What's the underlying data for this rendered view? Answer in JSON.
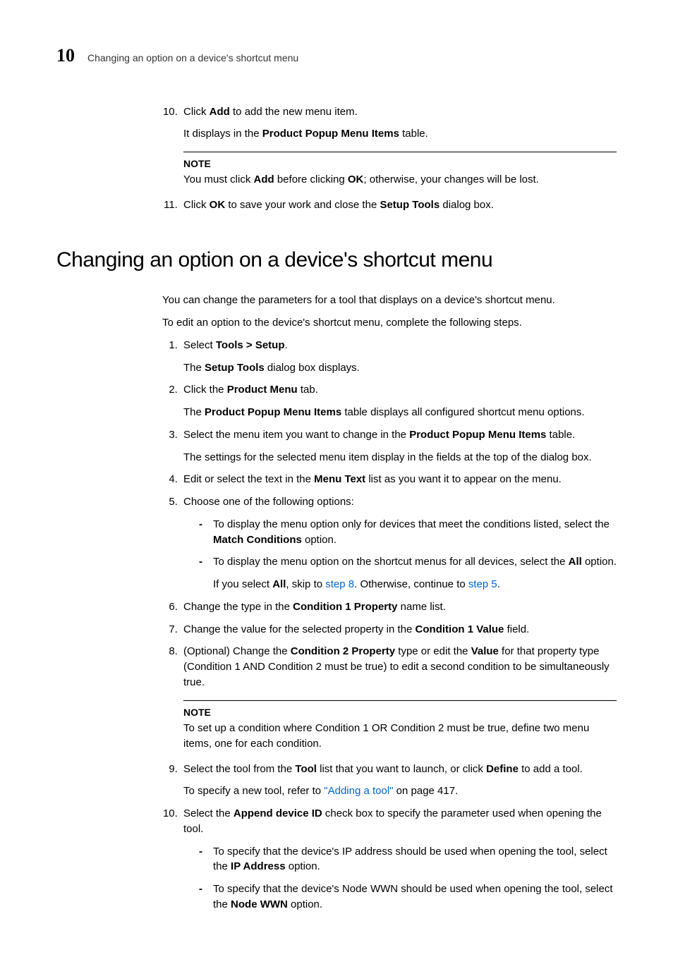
{
  "header": {
    "chapter": "10",
    "running": "Changing an option on a device's shortcut menu"
  },
  "top_steps": {
    "s10_a": "Click ",
    "s10_b": "Add",
    "s10_c": " to add the new menu item.",
    "s10_sub_a": "It displays in the ",
    "s10_sub_b": "Product Popup Menu Items",
    "s10_sub_c": " table.",
    "note_label": "NOTE",
    "note_a": "You must click ",
    "note_b": "Add",
    "note_c": " before clicking ",
    "note_d": "OK",
    "note_e": "; otherwise, your changes will be lost.",
    "s11_a": "Click ",
    "s11_b": "OK",
    "s11_c": " to save your work and close the ",
    "s11_d": "Setup Tools",
    "s11_e": " dialog box."
  },
  "section_title": "Changing an option on a device's shortcut menu",
  "intro1": "You can change the parameters for a tool that displays on a device's shortcut menu.",
  "intro2": "To edit an option to the device's shortcut menu, complete the following steps.",
  "steps": {
    "s1_a": "Select ",
    "s1_b": "Tools > Setup",
    "s1_c": ".",
    "s1_sub_a": "The ",
    "s1_sub_b": "Setup Tools",
    "s1_sub_c": " dialog box displays.",
    "s2_a": "Click the ",
    "s2_b": "Product Menu",
    "s2_c": " tab.",
    "s2_sub_a": "The ",
    "s2_sub_b": "Product Popup Menu Items",
    "s2_sub_c": " table displays all configured shortcut menu options.",
    "s3_a": "Select the menu item you want to change in the ",
    "s3_b": "Product Popup Menu Items",
    "s3_c": " table.",
    "s3_sub": "The settings for the selected menu item display in the fields at the top of the dialog box.",
    "s4_a": "Edit or select the text in the ",
    "s4_b": "Menu Text",
    "s4_c": " list as you want it to appear on the menu.",
    "s5": "Choose one of the following options:",
    "s5_b1_a": "To display the menu option only for devices that meet the conditions listed, select the ",
    "s5_b1_b": "Match Conditions",
    "s5_b1_c": " option.",
    "s5_b2_a": "To display the menu option on the shortcut menus for all devices, select the ",
    "s5_b2_b": "All",
    "s5_b2_c": " option.",
    "s5_b2_sub_a": "If you select ",
    "s5_b2_sub_b": "All",
    "s5_b2_sub_c": ", skip to ",
    "s5_b2_sub_link1": "step 8",
    "s5_b2_sub_d": ". Otherwise, continue to ",
    "s5_b2_sub_link2": "step 5",
    "s5_b2_sub_e": ".",
    "s6_a": "Change the type in the ",
    "s6_b": "Condition 1 Property",
    "s6_c": " name list.",
    "s7_a": "Change the value for the selected property in the ",
    "s7_b": "Condition 1 Value",
    "s7_c": " field.",
    "s8_a": "(Optional) Change the ",
    "s8_b": "Condition 2 Property",
    "s8_c": " type or edit the ",
    "s8_d": "Value",
    "s8_e": " for that property type (Condition 1 AND Condition 2 must be true) to edit a second condition to be simultaneously true.",
    "note2_label": "NOTE",
    "note2_text": "To set up a condition where Condition 1 OR Condition 2 must be true, define two menu items, one for each condition.",
    "s9_a": "Select the tool from the ",
    "s9_b": "Tool",
    "s9_c": " list that you want to launch, or click ",
    "s9_d": "Define",
    "s9_e": " to add a tool.",
    "s9_sub_a": "To specify a new tool, refer to ",
    "s9_sub_link": "\"Adding a tool\"",
    "s9_sub_b": " on page 417.",
    "s10_a": "Select the ",
    "s10_b": "Append device ID",
    "s10_c": " check box to specify the parameter used when opening the tool.",
    "s10_b1_a": "To specify that the device's IP address should be used when opening the tool, select the ",
    "s10_b1_b": "IP Address",
    "s10_b1_c": " option.",
    "s10_b2_a": "To specify that the device's Node WWN should be used when opening the tool, select the ",
    "s10_b2_b": "Node WWN",
    "s10_b2_c": " option."
  }
}
